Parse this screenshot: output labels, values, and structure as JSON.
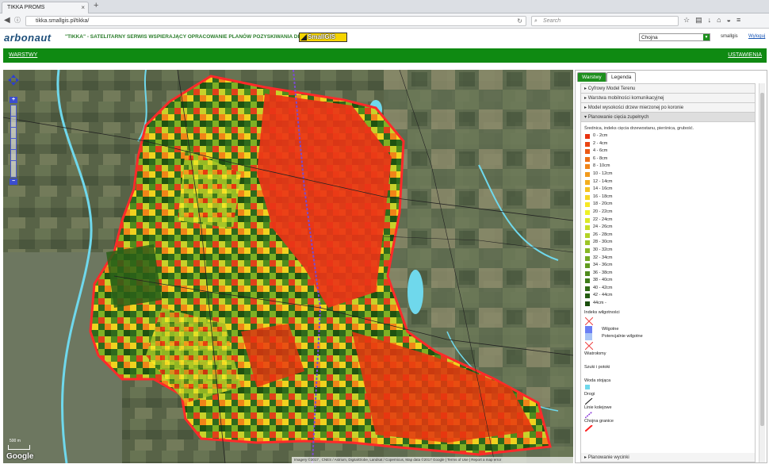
{
  "browser": {
    "tab_title": "TIKKA PROMS",
    "tab_close": "×",
    "new_tab": "+",
    "url": "tikka.smallgis.pl/tikka/",
    "search_placeholder": "Search"
  },
  "header": {
    "logo": "arbonaut",
    "tagline": "\"TIKKA\" - SATELITARNY SERWIS WSPIERAJĄCY OPRACOWANIE PLANÓW POZYSKIWANIA DREWNA",
    "partner_logo": "SmallGIS",
    "region_selected": "Chojna",
    "username": "smallgis",
    "logout": "Wyloguj"
  },
  "toolbar": {
    "layers_link": "WARSTWY",
    "settings_link": "USTAWIENIA"
  },
  "map": {
    "google_label": "Google",
    "scale_label": "500 m",
    "attribution": "Imagery ©2017 , CNES / Astrium, DigitalGlobe, Landsat / Copernicus, Map data ©2017 Google | Terms of Use | Report a map error"
  },
  "panel": {
    "tabs": [
      "Warstwy",
      "Legenda"
    ],
    "active_tab": "Legenda",
    "sections": [
      {
        "label": "Cyfrowy Model Terenu",
        "expanded": false
      },
      {
        "label": "Warstwa mobilności komunikacyjnej",
        "expanded": false
      },
      {
        "label": "Model wysokości drzew mierzonej po koronie",
        "expanded": false
      },
      {
        "label": "Planowanie cięcia zupełnych",
        "expanded": true
      }
    ],
    "legend_title": "Średnica, indeks cięcia drzewostanu, pierśnica, grubość.",
    "legend_items": [
      {
        "label": "0 - 2cm",
        "color": "#e8320f"
      },
      {
        "label": "2 - 4cm",
        "color": "#ea4512"
      },
      {
        "label": "4 - 6cm",
        "color": "#ec5a14"
      },
      {
        "label": "6 - 8cm",
        "color": "#ee7016"
      },
      {
        "label": "8 - 10cm",
        "color": "#f08418"
      },
      {
        "label": "10 - 12cm",
        "color": "#f29a1b"
      },
      {
        "label": "12 - 14cm",
        "color": "#f4ae1e"
      },
      {
        "label": "14 - 16cm",
        "color": "#f5c220"
      },
      {
        "label": "16 - 18cm",
        "color": "#f6d622"
      },
      {
        "label": "18 - 20cm",
        "color": "#f7e824"
      },
      {
        "label": "20 - 22cm",
        "color": "#eef225"
      },
      {
        "label": "22 - 24cm",
        "color": "#dbe826"
      },
      {
        "label": "24 - 26cm",
        "color": "#c7dd26"
      },
      {
        "label": "26 - 28cm",
        "color": "#b2d226"
      },
      {
        "label": "28 - 30cm",
        "color": "#9dc526"
      },
      {
        "label": "30 - 32cm",
        "color": "#88b825"
      },
      {
        "label": "32 - 34cm",
        "color": "#74aa23"
      },
      {
        "label": "34 - 36cm",
        "color": "#619b20"
      },
      {
        "label": "36 - 38cm",
        "color": "#4f8b1d"
      },
      {
        "label": "38 - 40cm",
        "color": "#3e7b19"
      },
      {
        "label": "40 - 42cm",
        "color": "#306b15"
      },
      {
        "label": "42 - 44cm",
        "color": "#245c11"
      },
      {
        "label": "44cm -",
        "color": "#1a4e0d"
      }
    ],
    "moisture_title": "Indeks wilgotności",
    "moisture_items": [
      "Wilgotne",
      "Potencjalnie wilgotne"
    ],
    "extra_labels": [
      "Wiatrołomy",
      "Szuki i potoki",
      "Woda stojąca",
      "Drogi",
      "Linie kolejowe",
      "Chojna granice"
    ],
    "bottom_section": "Planowanie wycinki"
  }
}
